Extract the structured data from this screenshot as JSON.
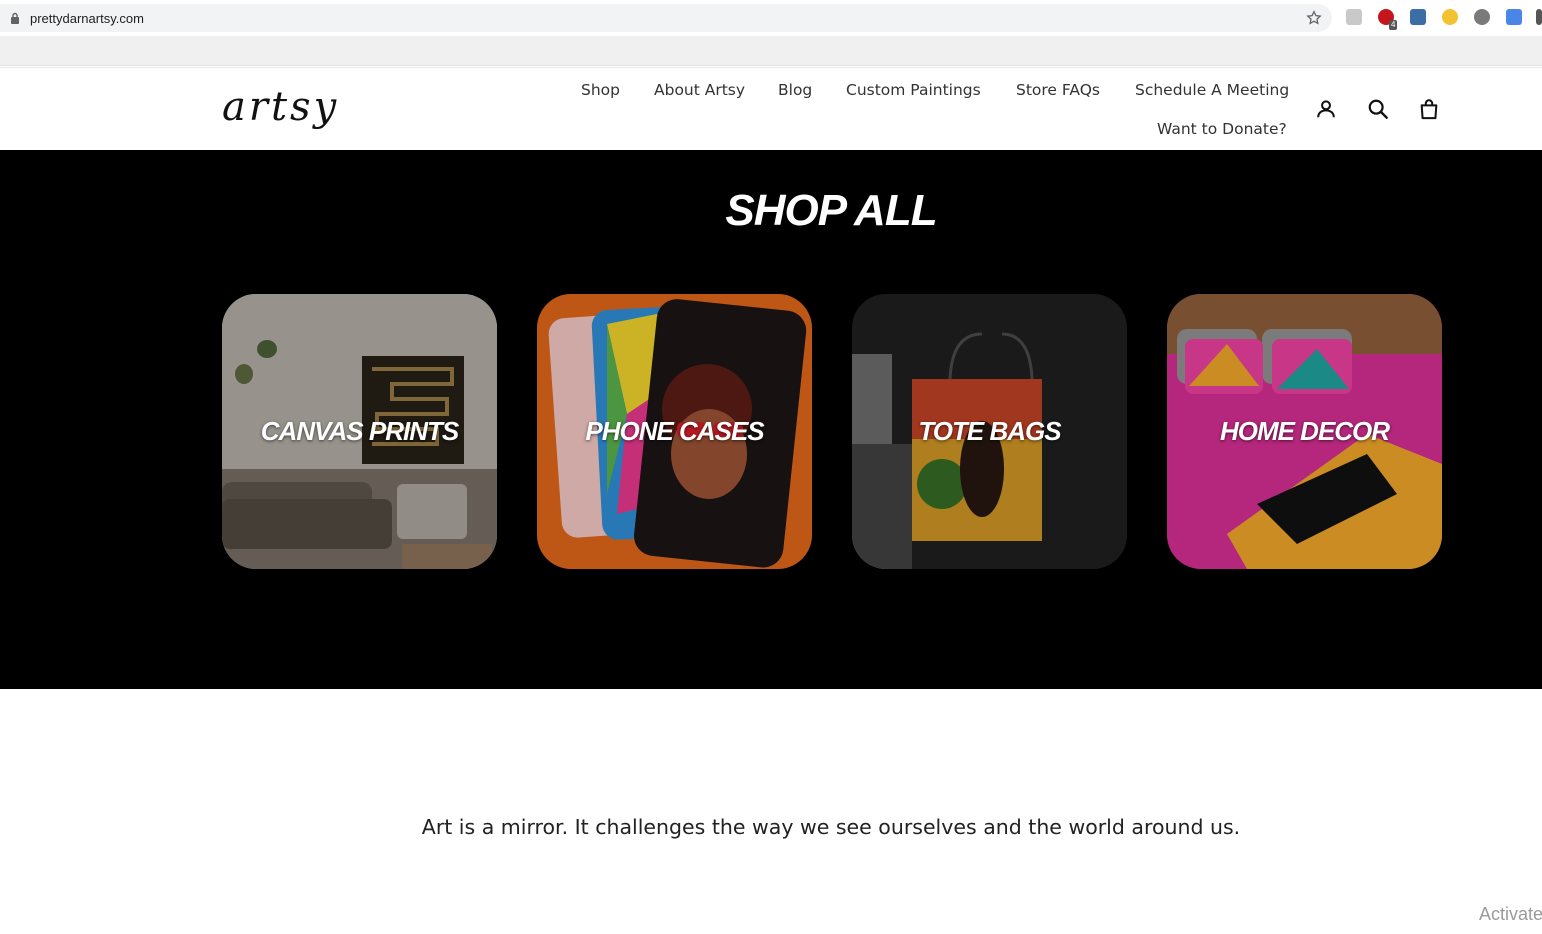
{
  "browser": {
    "url": "prettydarnartsy.com",
    "ext_badge": "4"
  },
  "header": {
    "logo": "artsy",
    "nav": [
      {
        "label": "Shop"
      },
      {
        "label": "About Artsy"
      },
      {
        "label": "Blog"
      },
      {
        "label": "Custom Paintings"
      },
      {
        "label": "Store FAQs"
      },
      {
        "label": "Schedule A Meeting"
      },
      {
        "label": "Want to Donate?"
      }
    ],
    "icons": [
      "account-icon",
      "search-icon",
      "cart-icon"
    ]
  },
  "shop": {
    "title": "SHOP ALL",
    "categories": [
      {
        "label": "CANVAS PRINTS"
      },
      {
        "label": "PHONE CASES"
      },
      {
        "label": "TOTE BAGS"
      },
      {
        "label": "HOME DECOR"
      }
    ]
  },
  "quote": "Art is a mirror. It challenges the way we see ourselves and the world around us.",
  "watermark": "Activate",
  "colors": {
    "section_bg": "#000000",
    "text_dark": "#333333"
  }
}
